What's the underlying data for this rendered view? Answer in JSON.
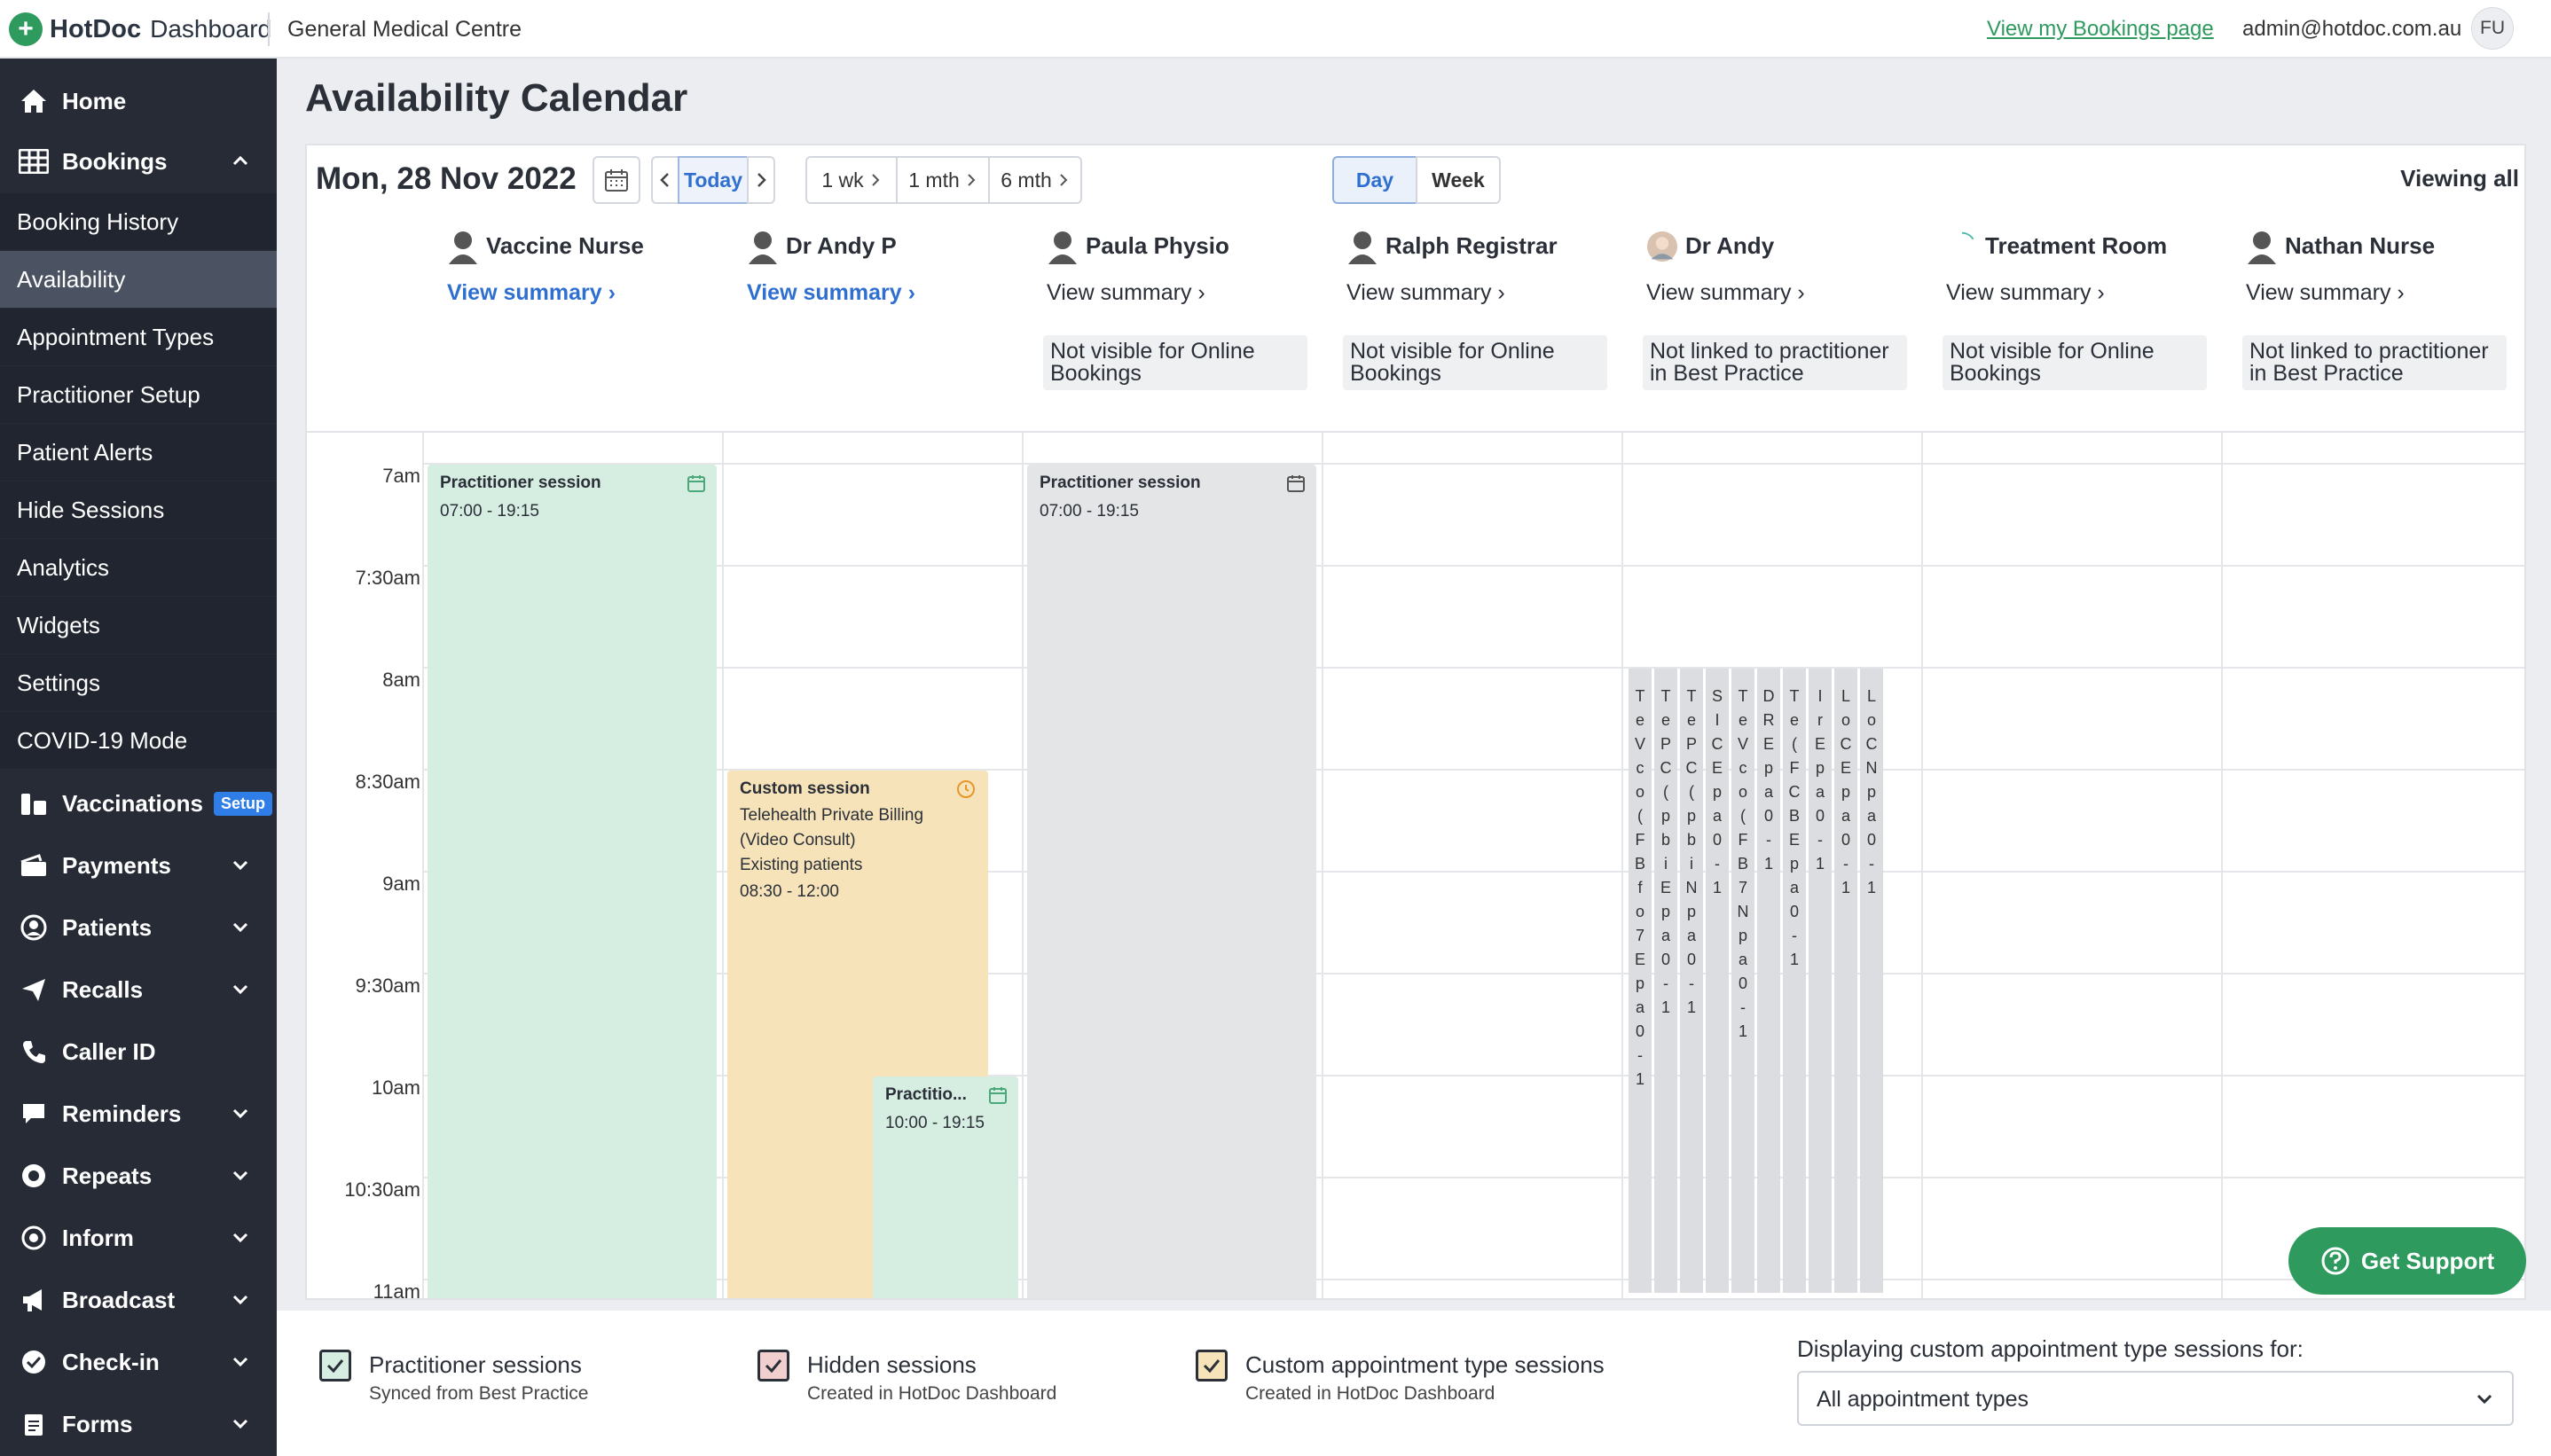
{
  "topbar": {
    "logo_text": "HotDoc",
    "logo_sub": "Dashboard",
    "org_name": "General Medical Centre",
    "bookings_link": "View my Bookings page",
    "admin_email": "admin@hotdoc.com.au",
    "user_initials": "FU"
  },
  "sidebar": {
    "home": "Home",
    "bookings": "Bookings",
    "sub_items": [
      "Booking History",
      "Availability",
      "Appointment Types",
      "Practitioner Setup",
      "Patient Alerts",
      "Hide Sessions",
      "Analytics",
      "Widgets",
      "Settings",
      "COVID-19 Mode"
    ],
    "active_sub": "Availability",
    "vaccinations": "Vaccinations",
    "setup_badge": "Setup",
    "lower_items": [
      "Payments",
      "Patients",
      "Recalls",
      "Caller ID",
      "Reminders",
      "Repeats",
      "Inform",
      "Broadcast",
      "Check-in",
      "Forms"
    ]
  },
  "page": {
    "title": "Availability Calendar"
  },
  "toolbar": {
    "date": "Mon, 28 Nov 2022",
    "today": "Today",
    "range_buttons": [
      "1 wk",
      "1 mth",
      "6 mth"
    ],
    "view_day": "Day",
    "view_week": "Week",
    "viewing": "Viewing all"
  },
  "practitioners": [
    {
      "name": "Vaccine Nurse",
      "summary": "View summary",
      "note": ""
    },
    {
      "name": "Dr Andy P",
      "summary": "View summary",
      "note": ""
    },
    {
      "name": "Paula Physio",
      "summary": "View summary",
      "note": "Not visible for Online Bookings"
    },
    {
      "name": "Ralph Registrar",
      "summary": "View summary",
      "note": "Not visible for Online Bookings"
    },
    {
      "name": "Dr Andy",
      "summary": "View summary",
      "note": "Not linked to practitioner in Best Practice"
    },
    {
      "name": "Treatment Room",
      "summary": "View summary",
      "note": "Not visible for Online Bookings"
    },
    {
      "name": "Nathan Nurse",
      "summary": "View summary",
      "note": "Not linked to practitioner in Best Practice"
    }
  ],
  "times": [
    "7am",
    "7:30am",
    "8am",
    "8:30am",
    "9am",
    "9:30am",
    "10am",
    "10:30am",
    "11am"
  ],
  "sessions": {
    "s1": {
      "title": "Practitioner session",
      "time": "07:00 - 19:15"
    },
    "s2": {
      "title": "Practitioner session",
      "time": "07:00 - 19:15"
    },
    "s3": {
      "title": "Custom session",
      "line1": "Telehealth Private Billing",
      "line2": "(Video Consult)",
      "line3": "Existing patients",
      "time": "08:30 - 12:00"
    },
    "s4": {
      "title": "Practitio...",
      "time": "10:00 - 19:15"
    }
  },
  "strips": [
    "TeVco(FBfo7Epa0-1",
    "TePC(pbiEpa0-1",
    "TePC(pbiNpa0-1",
    "SICEpa0-1",
    "TeVco(FB7Npa0-1",
    "DREpa0-1",
    "Te(FCBEpa0-1",
    "IrEpa0-1",
    "LoCEpa0-1",
    "LoCNpa0-1"
  ],
  "support": "Get Support",
  "footer": {
    "legend": [
      {
        "title": "Practitioner sessions",
        "sub": "Synced from Best Practice"
      },
      {
        "title": "Hidden sessions",
        "sub": "Created in HotDoc Dashboard"
      },
      {
        "title": "Custom appointment type sessions",
        "sub": "Created in HotDoc Dashboard"
      }
    ],
    "display_label": "Displaying custom appointment type sessions for:",
    "select_value": "All appointment types"
  },
  "colors": {
    "brand": "#2e9a5e",
    "link": "#2f6fd0",
    "sidebar": "#262b36",
    "practitioner_session": "#d6ede1",
    "custom_session": "#f7e3b9"
  }
}
